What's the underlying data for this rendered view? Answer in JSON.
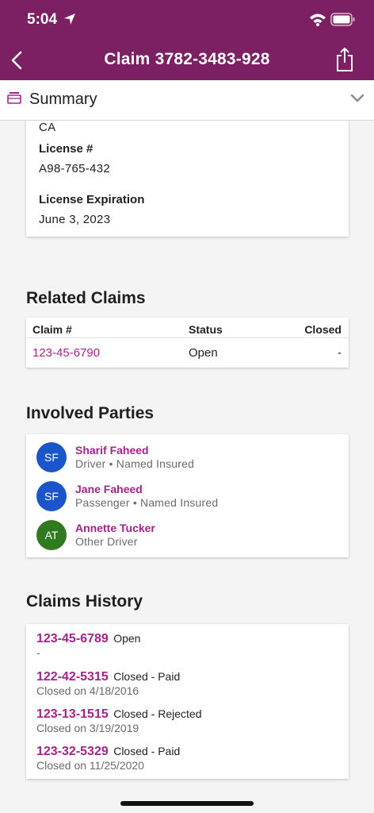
{
  "status_bar": {
    "time": "5:04"
  },
  "nav": {
    "title": "Claim 3782-3483-928"
  },
  "summary_bar": {
    "label": "Summary"
  },
  "driver_card": {
    "state": "CA",
    "license_label": "License #",
    "license_value": "A98-765-432",
    "expiration_label": "License Expiration",
    "expiration_value": "June 3, 2023"
  },
  "related_claims": {
    "title": "Related Claims",
    "headers": {
      "claim": "Claim #",
      "status": "Status",
      "closed": "Closed"
    },
    "rows": [
      {
        "claim": "123-45-6790",
        "status": "Open",
        "closed": "-"
      }
    ]
  },
  "involved_parties": {
    "title": "Involved Parties",
    "parties": [
      {
        "initials": "SF",
        "name": "Sharif Faheed",
        "role": "Driver • Named Insured",
        "avatar_color": "#1a56c9"
      },
      {
        "initials": "SF",
        "name": "Jane Faheed",
        "role": "Passenger • Named Insured",
        "avatar_color": "#1a56c9"
      },
      {
        "initials": "AT",
        "name": "Annette Tucker",
        "role": "Other Driver",
        "avatar_color": "#2f7a1f"
      }
    ]
  },
  "claims_history": {
    "title": "Claims History",
    "items": [
      {
        "number": "123-45-6789",
        "status": "Open",
        "sub": "-"
      },
      {
        "number": "122-42-5315",
        "status": "Closed - Paid",
        "sub": "Closed on 4/18/2016"
      },
      {
        "number": "123-13-1515",
        "status": "Closed - Rejected",
        "sub": "Closed on 3/19/2019"
      },
      {
        "number": "123-32-5329",
        "status": "Closed - Paid",
        "sub": "Closed on 11/25/2020"
      }
    ]
  },
  "colors": {
    "brand": "#7c1f63",
    "link": "#a3238b",
    "avatar_blue": "#1a56c9",
    "avatar_green": "#2f7a1f"
  }
}
